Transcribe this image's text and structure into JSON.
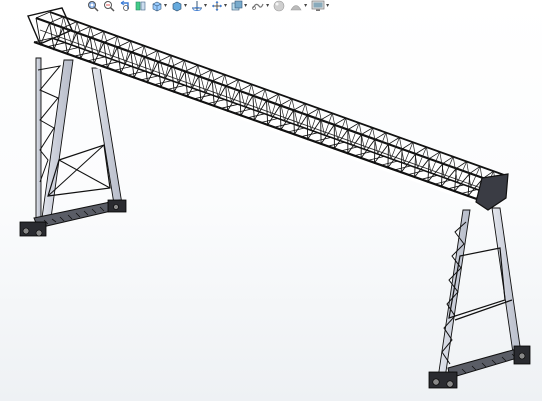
{
  "view": {
    "background_top": "#ffffff",
    "background_bottom": "#eef1f4",
    "model_color": "#1c1c1e",
    "leg_color": "#cfd3de",
    "hud_accent": "#3a7bd5"
  },
  "heads_up_toolbar": {
    "items": [
      {
        "name": "zoom-to-fit-icon",
        "dropdown": false
      },
      {
        "name": "zoom-to-area-icon",
        "dropdown": false
      },
      {
        "name": "previous-view-icon",
        "dropdown": false
      },
      {
        "name": "section-view-icon",
        "dropdown": false
      },
      {
        "name": "view-orientation-icon",
        "dropdown": true
      },
      {
        "name": "display-style-icon",
        "dropdown": true
      },
      {
        "name": "hide-show-items-icon",
        "dropdown": true
      },
      {
        "name": "edit-appearance-icon",
        "dropdown": true
      },
      {
        "name": "apply-scene-icon",
        "dropdown": true
      },
      {
        "name": "view-settings-icon",
        "dropdown": true
      }
    ]
  }
}
